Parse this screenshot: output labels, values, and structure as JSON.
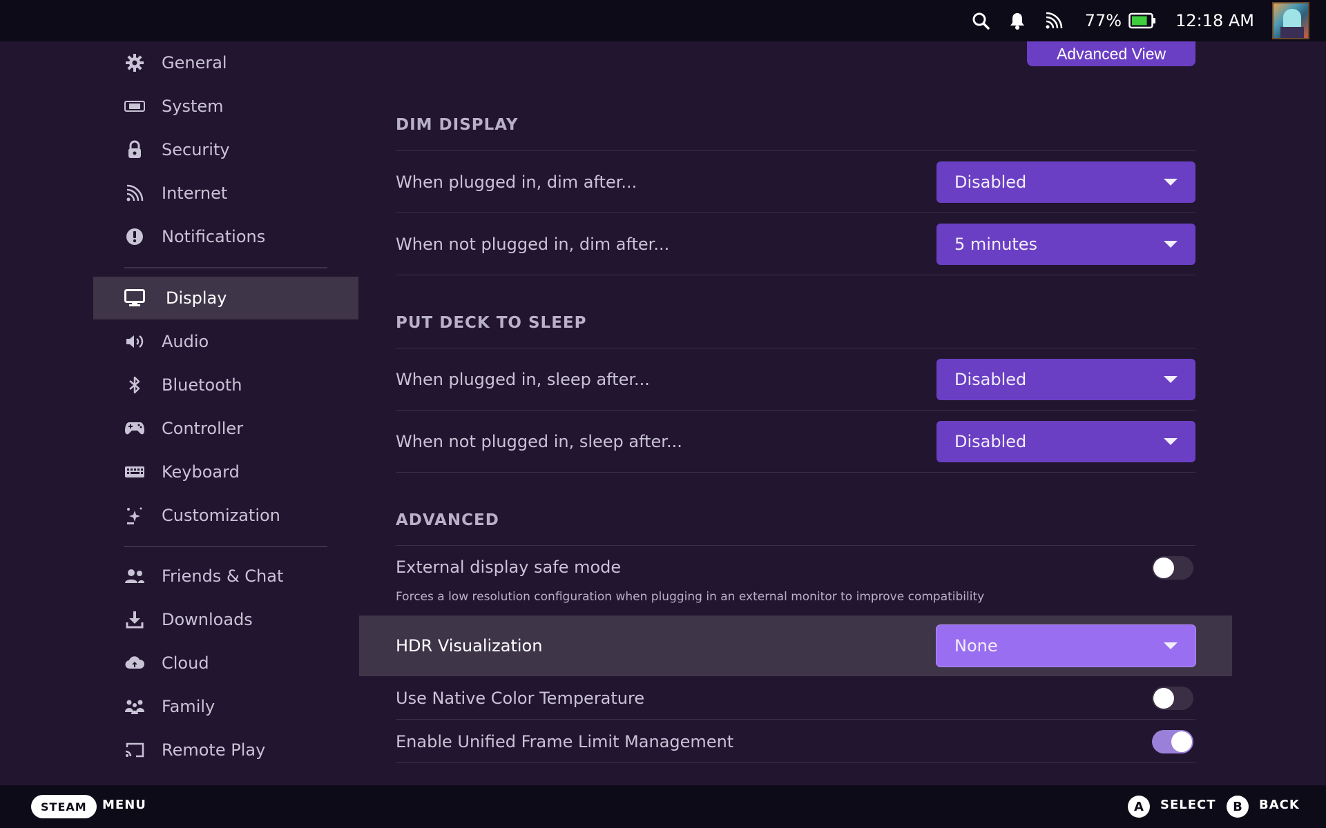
{
  "topbar": {
    "battery_percent": "77%",
    "battery_level": 0.77,
    "clock": "12:18 AM",
    "icons": [
      "search-icon",
      "bell-icon",
      "cast-icon",
      "battery-icon"
    ]
  },
  "sidebar": {
    "items": [
      {
        "label": "General",
        "icon": "gear-icon"
      },
      {
        "label": "System",
        "icon": "deck-icon"
      },
      {
        "label": "Security",
        "icon": "lock-icon"
      },
      {
        "label": "Internet",
        "icon": "rss-icon"
      },
      {
        "label": "Notifications",
        "icon": "alert-icon"
      },
      {
        "label": "Display",
        "icon": "monitor-icon",
        "active": true
      },
      {
        "label": "Audio",
        "icon": "speaker-icon"
      },
      {
        "label": "Bluetooth",
        "icon": "bluetooth-icon"
      },
      {
        "label": "Controller",
        "icon": "gamepad-icon"
      },
      {
        "label": "Keyboard",
        "icon": "keyboard-icon"
      },
      {
        "label": "Customization",
        "icon": "sparkle-icon"
      },
      {
        "label": "Friends & Chat",
        "icon": "friends-icon"
      },
      {
        "label": "Downloads",
        "icon": "download-icon"
      },
      {
        "label": "Cloud",
        "icon": "cloud-icon"
      },
      {
        "label": "Family",
        "icon": "family-icon"
      },
      {
        "label": "Remote Play",
        "icon": "cast-icon"
      }
    ]
  },
  "main": {
    "advanced_view_label": "Advanced View",
    "dim_display": {
      "title": "DIM DISPLAY",
      "plugged_label": "When plugged in, dim after...",
      "plugged_value": "Disabled",
      "unplugged_label": "When not plugged in, dim after...",
      "unplugged_value": "5 minutes"
    },
    "sleep": {
      "title": "PUT DECK TO SLEEP",
      "plugged_label": "When plugged in, sleep after...",
      "plugged_value": "Disabled",
      "unplugged_label": "When not plugged in, sleep after...",
      "unplugged_value": "Disabled"
    },
    "advanced": {
      "title": "ADVANCED",
      "safe_mode_label": "External display safe mode",
      "safe_mode_desc": "Forces a low resolution configuration when plugging in an external monitor to improve compatibility",
      "safe_mode_on": false,
      "hdr_label": "HDR Visualization",
      "hdr_value": "None",
      "native_color_label": "Use Native Color Temperature",
      "native_color_on": false,
      "frame_limit_label": "Enable Unified Frame Limit Management",
      "frame_limit_on": true
    }
  },
  "bottombar": {
    "steam_label": "STEAM",
    "menu_label": "MENU",
    "a_glyph": "A",
    "select_label": "SELECT",
    "b_glyph": "B",
    "back_label": "BACK"
  },
  "colors": {
    "background": "#22152f",
    "bar": "#0e0b18",
    "accent": "#6a3fc3",
    "accent_focused": "#9a6ef0",
    "highlight_row": "#3e3549"
  }
}
